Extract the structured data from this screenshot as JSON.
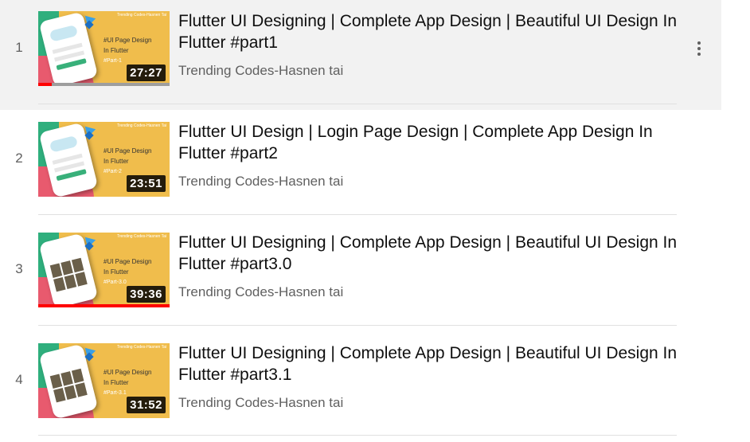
{
  "playlist": {
    "items": [
      {
        "index": "1",
        "title": "Flutter UI Designing | Complete App Design | Beautiful UI Design In Flutter #part1",
        "channel": "Trending Codes-Hasnen tai",
        "duration": "27:27",
        "thumb_line1": "#UI Page Design",
        "thumb_line2": "In Flutter",
        "thumb_line3": "#Part-1",
        "thumb_corner": "Trending Codes-Hasnen Tai",
        "watched_fraction": 0.1,
        "active": true
      },
      {
        "index": "2",
        "title": "Flutter UI Design | Login Page Design | Complete App Design In Flutter #part2",
        "channel": "Trending Codes-Hasnen tai",
        "duration": "23:51",
        "thumb_line1": "#UI Page Design",
        "thumb_line2": "In Flutter",
        "thumb_line3": "#Part-2",
        "thumb_corner": "Trending Codes-Hasnen Tai",
        "watched_fraction": 0,
        "active": false
      },
      {
        "index": "3",
        "title": "Flutter UI Designing | Complete App Design | Beautiful UI Design In Flutter #part3.0",
        "channel": "Trending Codes-Hasnen tai",
        "duration": "39:36",
        "thumb_line1": "#UI Page Design",
        "thumb_line2": "In Flutter",
        "thumb_line3": "#Part-3.0",
        "thumb_corner": "Trending Codes-Hasnen Tai",
        "watched_fraction": 1.0,
        "active": false
      },
      {
        "index": "4",
        "title": "Flutter UI Designing | Complete App Design | Beautiful UI Design In Flutter #part3.1",
        "channel": "Trending Codes-Hasnen tai",
        "duration": "31:52",
        "thumb_line1": "#UI Page Design",
        "thumb_line2": "In Flutter",
        "thumb_line3": "#Part-3.1",
        "thumb_corner": "Trending Codes-Hasnen Tai",
        "watched_fraction": 0,
        "active": false
      }
    ],
    "menu_icon": "more-vert-icon",
    "colors": {
      "progress": "#ff0000",
      "active_row": "#f2f2f2"
    }
  }
}
